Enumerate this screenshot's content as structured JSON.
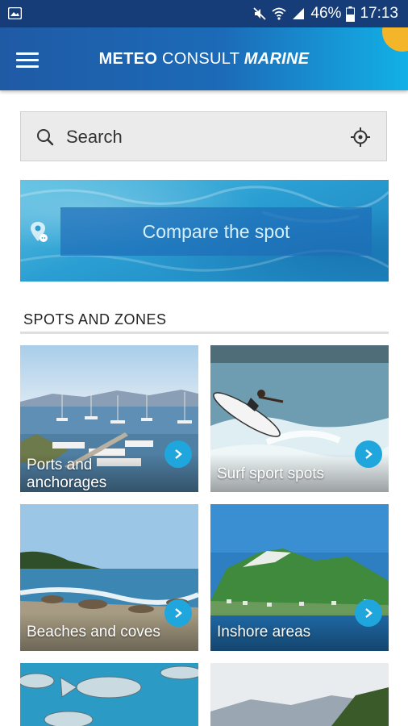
{
  "status_bar": {
    "battery": "46%",
    "time": "17:13",
    "icons": [
      "image-icon",
      "mute-icon",
      "wifi-icon",
      "signal-icon",
      "battery-icon"
    ]
  },
  "app_bar": {
    "brand_part1": "METEO",
    "brand_part2": " CONSULT ",
    "brand_part3": "MARINE",
    "menu_icon": "hamburger-menu-icon"
  },
  "search": {
    "placeholder": "Search",
    "icons": [
      "search-icon",
      "gps-locate-icon"
    ]
  },
  "compare": {
    "label": "Compare the spot",
    "icon": "map-pin-icon"
  },
  "section": {
    "title": "SPOTS AND ZONES"
  },
  "tiles": [
    {
      "label_line1": "Ports and",
      "label_line2": "anchorages"
    },
    {
      "label": "Surf sport spots"
    },
    {
      "label": "Beaches and coves"
    },
    {
      "label": "Inshore areas"
    },
    {
      "label": ""
    },
    {
      "label": ""
    }
  ],
  "colors": {
    "status_bar": "#173d78",
    "app_bar_start": "#1f5aa5",
    "app_bar_end": "#12b0e6",
    "accent_arrow": "#1fa6dc",
    "search_bg": "#ebebeb"
  }
}
